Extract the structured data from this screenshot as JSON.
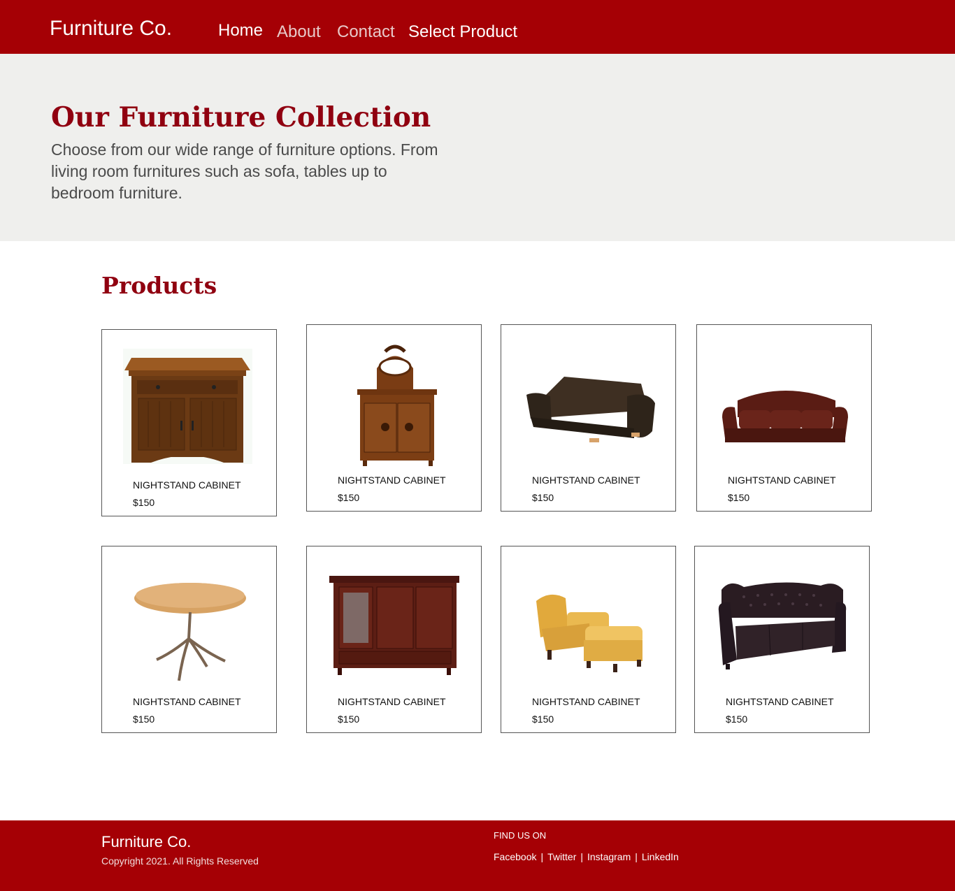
{
  "header": {
    "brand": "Furniture Co.",
    "nav": {
      "home": "Home",
      "about": "About",
      "contact": "Contact",
      "select_product": "Select Product"
    }
  },
  "hero": {
    "title": "Our Furniture Collection",
    "subtitle": "Choose from our wide range of furniture options. From living room furnitures such as sofa, tables up to bedroom furniture."
  },
  "products": {
    "title": "Products",
    "items": [
      {
        "name": "NIGHTSTAND CABINET",
        "price": "$150",
        "image": "nightstand-cabinet"
      },
      {
        "name": "NIGHTSTAND CABINET",
        "price": "$150",
        "image": "antique-sideboard"
      },
      {
        "name": "NIGHTSTAND CABINET",
        "price": "$150",
        "image": "dark-leather-sofa"
      },
      {
        "name": "NIGHTSTAND CABINET",
        "price": "$150",
        "image": "red-leather-sofa"
      },
      {
        "name": "NIGHTSTAND CABINET",
        "price": "$150",
        "image": "round-table"
      },
      {
        "name": "NIGHTSTAND CABINET",
        "price": "$150",
        "image": "media-cabinet"
      },
      {
        "name": "NIGHTSTAND CABINET",
        "price": "$150",
        "image": "yellow-armchair-ottoman"
      },
      {
        "name": "NIGHTSTAND CABINET",
        "price": "$150",
        "image": "tufted-leather-sofa"
      }
    ]
  },
  "footer": {
    "brand": "Furniture Co.",
    "copyright": "Copyright 2021. All Rights Reserved",
    "find_us": "FIND US ON",
    "links": {
      "facebook": "Facebook",
      "twitter": "Twitter",
      "instagram": "Instagram",
      "linkedin": "LinkedIn"
    },
    "separator": "|"
  },
  "colors": {
    "brand_red": "#a50005",
    "heading_red": "#900010",
    "hero_bg": "#efefed"
  }
}
